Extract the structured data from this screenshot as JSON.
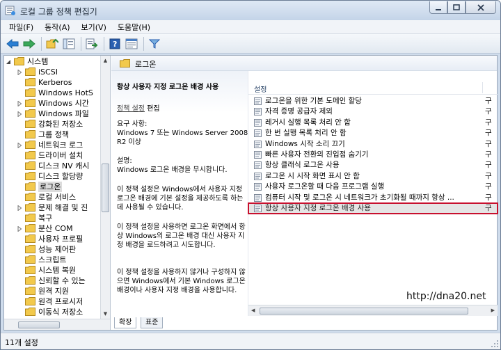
{
  "window": {
    "title": "로컬 그룹 정책 편집기"
  },
  "menu": [
    {
      "label": "파일(F)"
    },
    {
      "label": "동작(A)"
    },
    {
      "label": "보기(V)"
    },
    {
      "label": "도움말(H)"
    }
  ],
  "tree": {
    "items": [
      {
        "label": "시스템",
        "level": 0,
        "expanded": true
      },
      {
        "label": "iSCSI",
        "level": 1,
        "expanded": false
      },
      {
        "label": "Kerberos",
        "level": 1,
        "expanded": null
      },
      {
        "label": "Windows HotS",
        "level": 1,
        "expanded": null
      },
      {
        "label": "Windows 시간",
        "level": 1,
        "expanded": false
      },
      {
        "label": "Windows 파일",
        "level": 1,
        "expanded": false
      },
      {
        "label": "강화된 저장소",
        "level": 1,
        "expanded": null
      },
      {
        "label": "그룹 정책",
        "level": 1,
        "expanded": null
      },
      {
        "label": "네트워크 로그",
        "level": 1,
        "expanded": false
      },
      {
        "label": "드라이버 설치",
        "level": 1,
        "expanded": null
      },
      {
        "label": "디스크 NV 캐시",
        "level": 1,
        "expanded": null
      },
      {
        "label": "디스크 할당량",
        "level": 1,
        "expanded": null
      },
      {
        "label": "로그온",
        "level": 1,
        "expanded": null,
        "selected": true
      },
      {
        "label": "로컬 서비스",
        "level": 1,
        "expanded": null
      },
      {
        "label": "문제 해결 및 진",
        "level": 1,
        "expanded": false
      },
      {
        "label": "복구",
        "level": 1,
        "expanded": null
      },
      {
        "label": "분산 COM",
        "level": 1,
        "expanded": false
      },
      {
        "label": "사용자 프로필",
        "level": 1,
        "expanded": null
      },
      {
        "label": "성능 제어판",
        "level": 1,
        "expanded": null
      },
      {
        "label": "스크립트",
        "level": 1,
        "expanded": null
      },
      {
        "label": "시스템 복원",
        "level": 1,
        "expanded": null
      },
      {
        "label": "신뢰할 수 있는",
        "level": 1,
        "expanded": null
      },
      {
        "label": "원격 지원",
        "level": 1,
        "expanded": null
      },
      {
        "label": "원격 프로시저",
        "level": 1,
        "expanded": null
      },
      {
        "label": "이동식 저장소",
        "level": 1,
        "expanded": null
      }
    ]
  },
  "pane": {
    "folder_title": "로그온",
    "column_setting": "설정"
  },
  "description": {
    "title": "항상 사용자 지정 로그온 배경 사용",
    "edit_link": "정책 설정",
    "edit_suffix": " 편집",
    "req_label": "요구 사항:",
    "req_text": "Windows 7 또는 Windows Server 2008 R2 이상",
    "desc_label": "설명:",
    "desc_text": "Windows 로그온 배경을 무시합니다.",
    "p1": "이 정책 설정은 Windows에서 사용자 지정 로그온 배경에 기본 설정을 제공하도록 하는 데 사용될 수 있습니다.",
    "p2": "이 정책 설정을 사용하면 로그온 화면에서 항상 Windows의 로그온 배경 대신 사용자 지정 배경을 로드하려고 시도합니다.",
    "p3": "이 정책 설정을 사용하지 않거나 구성하지 않으면 Windows에서 기본 Windows 로그온 배경이나 사용자 지정 배경을 사용합니다."
  },
  "settings": {
    "rows": [
      {
        "name": "로그온을 위한 기본 도메인 할당",
        "state": "구"
      },
      {
        "name": "자격 증명 공급자 제외",
        "state": "구"
      },
      {
        "name": "레거시 실행 목록 처리 안 함",
        "state": "구"
      },
      {
        "name": "한 번 실행 목록 처리 안 함",
        "state": "구"
      },
      {
        "name": "Windows 시작 소리 끄기",
        "state": "구"
      },
      {
        "name": "빠른 사용자 전환의 진입점 숨기기",
        "state": "구"
      },
      {
        "name": "항상 클래식 로그온 사용",
        "state": "구"
      },
      {
        "name": "로그온 시 시작 화면 표시 안 함",
        "state": "구"
      },
      {
        "name": "사용자 로그온할 때 다음 프로그램 실행",
        "state": "구"
      },
      {
        "name": "컴퓨터 시작 및 로그온 시 네트워크가 초기화될 때까지 항상 ...",
        "state": "구"
      },
      {
        "name": "항상 사용자 지정 로그온 배경 사용",
        "state": "구",
        "highlight": true
      }
    ]
  },
  "tabs": [
    {
      "label": "확장"
    },
    {
      "label": "표준"
    }
  ],
  "watermark": "http://dna20.net",
  "status": {
    "text": "11개 설정"
  },
  "colors": {
    "highlight_border": "#c8102e",
    "folder": "#f2c94c"
  }
}
